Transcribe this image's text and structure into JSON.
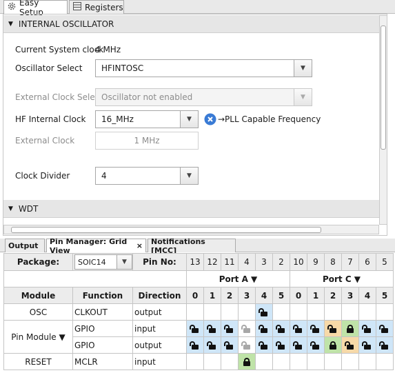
{
  "top_tabs": {
    "easy_setup": "Easy Setup",
    "registers": "Registers"
  },
  "sections": {
    "internal_oscillator": "INTERNAL OSCILLATOR",
    "wdt": "WDT"
  },
  "osc": {
    "current_clock_label": "Current System clock",
    "current_clock_value": "4 MHz",
    "osc_select_label": "Oscillator Select",
    "osc_select_value": "HFINTOSC",
    "ext_clock_select_label": "External Clock Select",
    "ext_clock_select_value": "Oscillator not enabled",
    "hf_internal_label": "HF Internal Clock",
    "hf_internal_value": "16_MHz",
    "pll_label": "→PLL Capable Frequency",
    "ext_clock_label": "External Clock",
    "ext_clock_value": "1 MHz",
    "clock_divider_label": "Clock Divider",
    "clock_divider_value": "4"
  },
  "bottom_tabs": {
    "output": "Output",
    "pin_manager": "Pin Manager: Grid View",
    "close": "×",
    "notifications": "Notifications [MCC]"
  },
  "grid": {
    "package_label": "Package:",
    "package_value": "SOIC14",
    "pin_no_label": "Pin No:",
    "pin_numbers": [
      "13",
      "12",
      "11",
      "4",
      "3",
      "2",
      "10",
      "9",
      "8",
      "7",
      "6",
      "5"
    ],
    "port_a": "Port A ▼",
    "port_c": "Port C ▼",
    "col_module": "Module",
    "col_function": "Function",
    "col_direction": "Direction",
    "port_bits": [
      "0",
      "1",
      "2",
      "3",
      "4",
      "5",
      "0",
      "1",
      "2",
      "3",
      "4",
      "5"
    ],
    "rows": [
      {
        "module": "OSC",
        "function": "CLKOUT",
        "direction": "output"
      },
      {
        "module": "Pin Module ▼",
        "function": "GPIO",
        "direction": "input"
      },
      {
        "module": "",
        "function": "GPIO",
        "direction": "output"
      },
      {
        "module": "RESET",
        "function": "MCLR",
        "direction": "input"
      }
    ]
  },
  "colors": {
    "available": "#cfe6f8",
    "selected": "#bfe3a8",
    "conflict": "#f7d9a8",
    "info": "#3a7bd5"
  }
}
